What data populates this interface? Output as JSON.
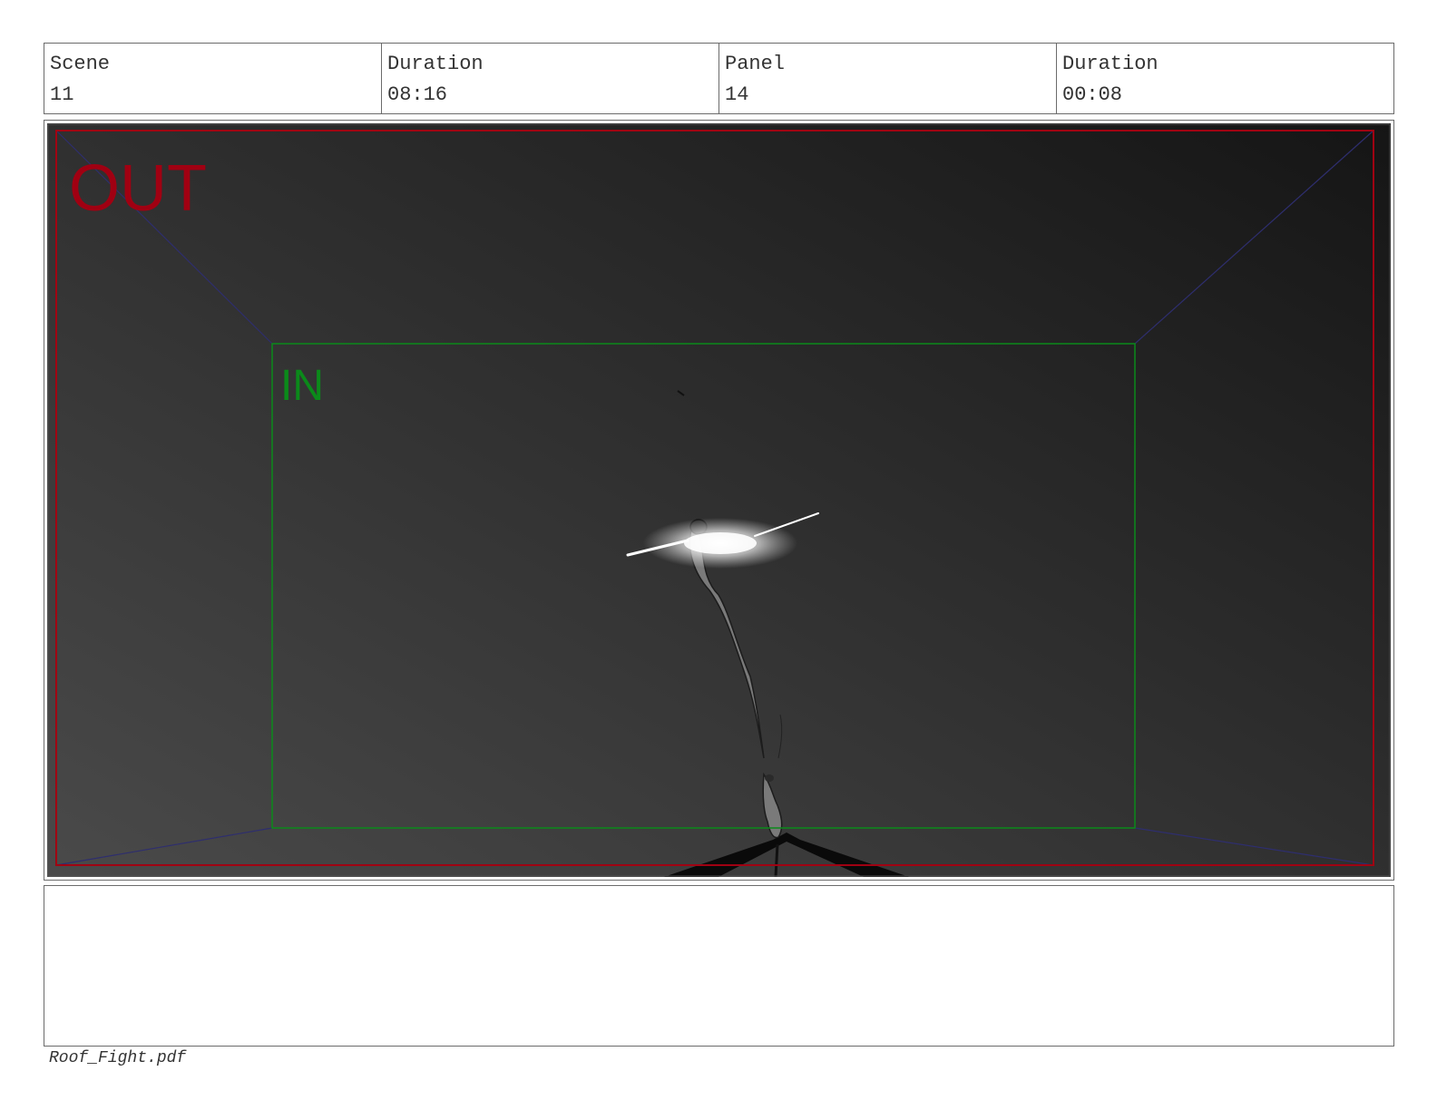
{
  "header": {
    "scene_label": "Scene",
    "scene_value": "11",
    "scene_duration_label": "Duration",
    "scene_duration_value": "08:16",
    "panel_label": "Panel",
    "panel_value": "14",
    "panel_duration_label": "Duration",
    "panel_duration_value": "00:08"
  },
  "frame": {
    "out_label": "OUT",
    "in_label": "IN",
    "colors": {
      "out_frame": "#a00012",
      "in_frame": "#0b8a1a",
      "perspective_lines": "#2e2e6e",
      "background_dark": "#151515",
      "background_light": "#4a4a4a"
    }
  },
  "notes": {
    "text": ""
  },
  "footer": {
    "filename": "Roof_Fight.pdf"
  }
}
